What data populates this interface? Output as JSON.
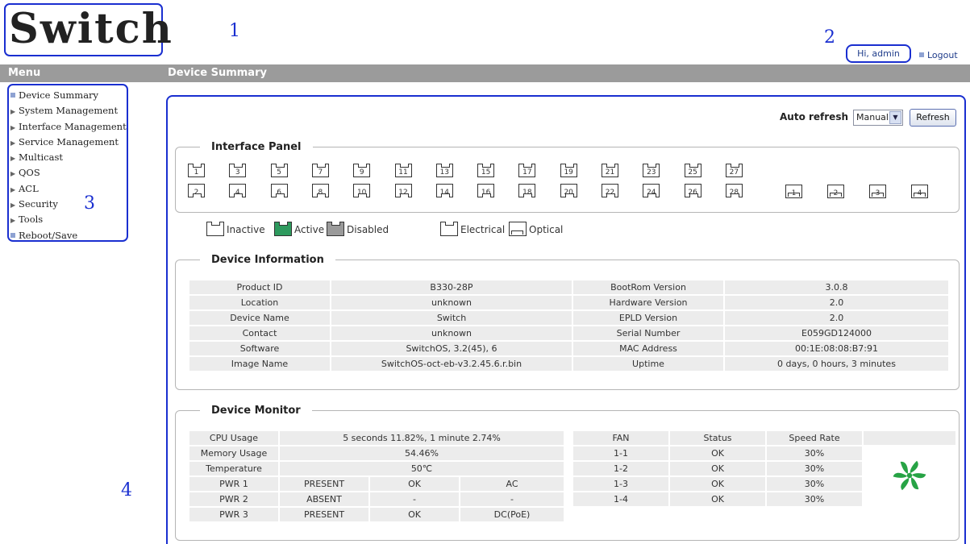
{
  "header": {
    "logo": "Switch",
    "annotations": [
      "1",
      "2",
      "3",
      "4"
    ],
    "greeting": "Hi, admin",
    "logout": "Logout"
  },
  "titlebar": {
    "menu": "Menu",
    "section": "Device Summary"
  },
  "sidebar": {
    "items": [
      {
        "label": "Device Summary",
        "marker": "square"
      },
      {
        "label": "System Management",
        "marker": "arrow"
      },
      {
        "label": "Interface Management",
        "marker": "arrow"
      },
      {
        "label": "Service Management",
        "marker": "arrow"
      },
      {
        "label": "Multicast",
        "marker": "arrow"
      },
      {
        "label": "QOS",
        "marker": "arrow"
      },
      {
        "label": "ACL",
        "marker": "arrow"
      },
      {
        "label": "Security",
        "marker": "arrow"
      },
      {
        "label": "Tools",
        "marker": "arrow"
      },
      {
        "label": "Reboot/Save",
        "marker": "square"
      }
    ]
  },
  "toolbar": {
    "auto_refresh_label": "Auto refresh",
    "refresh_mode": "Manual",
    "refresh_button": "Refresh"
  },
  "interface_panel": {
    "title": "Interface Panel",
    "ports_top": [
      "1",
      "3",
      "5",
      "7",
      "9",
      "11",
      "13",
      "15",
      "17",
      "19",
      "21",
      "23",
      "25",
      "27"
    ],
    "ports_bottom": [
      "2",
      "4",
      "6",
      "8",
      "10",
      "12",
      "14",
      "16",
      "18",
      "20",
      "22",
      "24",
      "26",
      "28"
    ],
    "sfp_ports": [
      "1",
      "2",
      "3",
      "4"
    ],
    "legend": {
      "inactive": "Inactive",
      "active": "Active",
      "disabled": "Disabled",
      "electrical": "Electrical",
      "optical": "Optical"
    },
    "colors": {
      "active": "#2e9a5e",
      "disabled": "#9a9a9a"
    }
  },
  "device_information": {
    "title": "Device Information",
    "rows": [
      [
        "Product ID",
        "B330-28P",
        "BootRom Version",
        "3.0.8"
      ],
      [
        "Location",
        "unknown",
        "Hardware Version",
        "2.0"
      ],
      [
        "Device Name",
        "Switch",
        "EPLD Version",
        "2.0"
      ],
      [
        "Contact",
        "unknown",
        "Serial Number",
        "E059GD124000"
      ],
      [
        "Software",
        "SwitchOS, 3.2(45), 6",
        "MAC Address",
        "00:1E:08:08:B7:91"
      ],
      [
        "Image Name",
        "SwitchOS-oct-eb-v3.2.45.6.r.bin",
        "Uptime",
        "0 days, 0 hours, 3 minutes"
      ]
    ]
  },
  "device_monitor": {
    "title": "Device Monitor",
    "cpu_label": "CPU Usage",
    "cpu_value": "5 seconds 11.82%, 1 minute 2.74%",
    "memory_label": "Memory Usage",
    "memory_value": "54.46%",
    "temp_label": "Temperature",
    "temp_value": "50℃",
    "power": [
      [
        "PWR 1",
        "PRESENT",
        "OK",
        "AC"
      ],
      [
        "PWR 2",
        "ABSENT",
        "-",
        "-"
      ],
      [
        "PWR 3",
        "PRESENT",
        "OK",
        "DC(PoE)"
      ]
    ],
    "fan_headers": [
      "FAN",
      "Status",
      "Speed Rate"
    ],
    "fans": [
      [
        "1-1",
        "OK",
        "30%"
      ],
      [
        "1-2",
        "OK",
        "30%"
      ],
      [
        "1-3",
        "OK",
        "30%"
      ],
      [
        "1-4",
        "OK",
        "30%"
      ]
    ],
    "fan_icon_color": "#27a345"
  }
}
